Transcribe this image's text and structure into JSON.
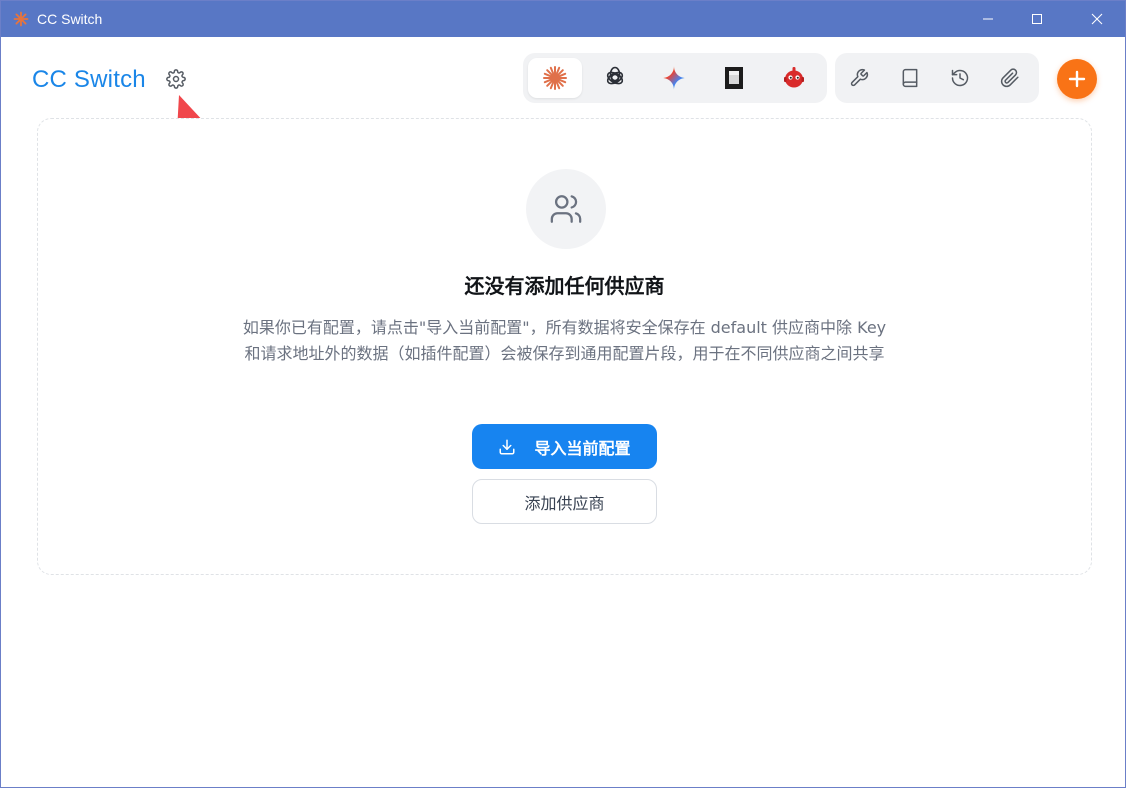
{
  "window": {
    "title": "CC Switch",
    "controls": [
      "minimize",
      "maximize",
      "close"
    ]
  },
  "header": {
    "brand": "CC Switch",
    "settings_icon": "gear-icon",
    "app_tabs": [
      {
        "name": "claude",
        "icon": "claude-sparkle-icon",
        "active": true
      },
      {
        "name": "openai",
        "icon": "openai-knot-icon",
        "active": false
      },
      {
        "name": "gemini",
        "icon": "gemini-star-icon",
        "active": false
      },
      {
        "name": "terminal",
        "icon": "terminal-box-icon",
        "active": false
      },
      {
        "name": "robot",
        "icon": "red-robot-icon",
        "active": false
      }
    ],
    "tools": [
      {
        "name": "wrench",
        "icon": "wrench-icon"
      },
      {
        "name": "book",
        "icon": "book-icon"
      },
      {
        "name": "history",
        "icon": "history-icon"
      },
      {
        "name": "attach",
        "icon": "paperclip-icon"
      }
    ],
    "add_icon": "plus-icon"
  },
  "empty_state": {
    "icon": "users-icon",
    "title": "还没有添加任何供应商",
    "description": "如果你已有配置，请点击\"导入当前配置\"，所有数据将安全保存在 default 供应商中除 Key 和请求地址外的数据（如插件配置）会被保存到通用配置片段，用于在不同供应商之间共享",
    "import_label": "导入当前配置",
    "add_label": "添加供应商"
  },
  "colors": {
    "titlebar": "#5877c5",
    "brand": "#1a86e8",
    "primary": "#1784f0",
    "fab": "#f97316",
    "arrow": "#f0474c"
  }
}
